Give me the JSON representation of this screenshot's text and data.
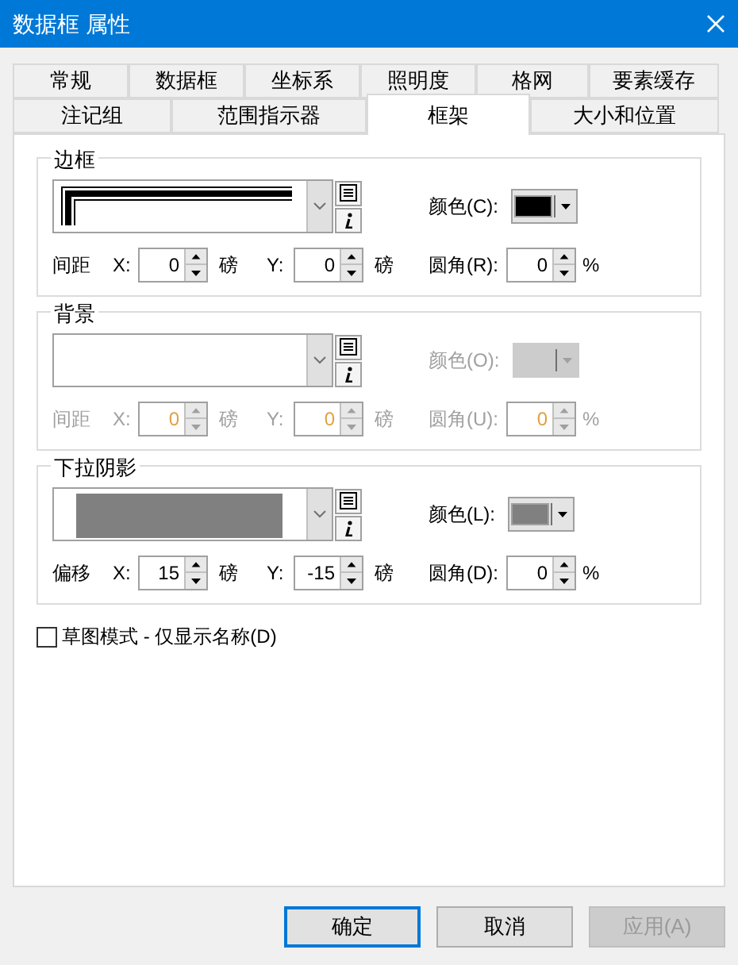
{
  "window": {
    "title": "数据框 属性"
  },
  "tab_rows": [
    [
      {
        "label": "常规",
        "selected": false
      },
      {
        "label": "数据框",
        "selected": false
      },
      {
        "label": "坐标系",
        "selected": false
      },
      {
        "label": "照明度",
        "selected": false
      },
      {
        "label": "格网",
        "selected": false
      },
      {
        "label": "要素缓存",
        "selected": false
      }
    ],
    [
      {
        "label": "注记组",
        "selected": false
      },
      {
        "label": "范围指示器",
        "selected": false
      },
      {
        "label": "框架",
        "selected": true
      },
      {
        "label": "大小和位置",
        "selected": false
      }
    ]
  ],
  "groups": [
    {
      "title": "边框",
      "disabled": false,
      "kind": "double_line",
      "color_label": "颜色(C):",
      "color": "#000000",
      "row_label": "间距",
      "x_label": "X:",
      "x_value": "0",
      "x_unit": "磅",
      "y_label": "Y:",
      "y_value": "0",
      "y_unit": "磅",
      "corner_label": "圆角(R):",
      "corner_value": "0",
      "corner_unit": "%"
    },
    {
      "title": "背景",
      "disabled": true,
      "kind": "empty",
      "color_label": "颜色(O):",
      "row_label": "间距",
      "x_label": "X:",
      "x_value": "0",
      "x_unit": "磅",
      "y_label": "Y:",
      "y_value": "0",
      "y_unit": "磅",
      "corner_label": "圆角(U):",
      "corner_value": "0",
      "corner_unit": "%"
    },
    {
      "title": "下拉阴影",
      "disabled": false,
      "kind": "fill",
      "color_label": "颜色(L):",
      "color": "#808080",
      "row_label": "偏移",
      "x_label": "X:",
      "x_value": "15",
      "x_unit": "磅",
      "y_label": "Y:",
      "y_value": "-15",
      "y_unit": "磅",
      "corner_label": "圆角(D):",
      "corner_value": "0",
      "corner_unit": "%"
    }
  ],
  "draft_mode": {
    "label": "草图模式 - 仅显示名称(D)",
    "checked": false
  },
  "buttons": [
    {
      "label": "确定",
      "disabled": false,
      "default": true
    },
    {
      "label": "取消",
      "disabled": false,
      "default": false
    },
    {
      "label": "应用(A)",
      "disabled": true,
      "default": false
    }
  ]
}
